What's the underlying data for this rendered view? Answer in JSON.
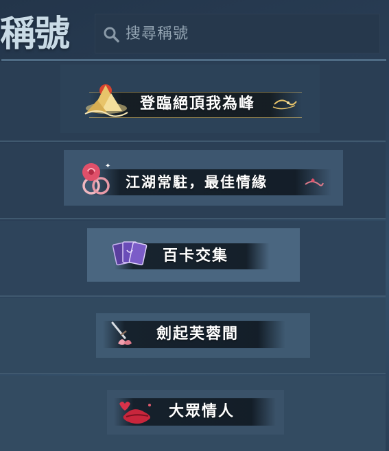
{
  "header": {
    "title": "稱號",
    "search": {
      "placeholder": "搜尋稱號",
      "icon": "search-icon"
    }
  },
  "titles": [
    {
      "label": "登臨絕頂我為峰",
      "icon": "golden-mountain-icon",
      "accent": "#e8c46a"
    },
    {
      "label": "江湖常駐，最佳情緣",
      "icon": "rose-rings-icon",
      "accent": "#e0506a"
    },
    {
      "label": "百卡交集",
      "icon": "purple-cards-icon",
      "accent": "#7b5cc8"
    },
    {
      "label": "劍起芙蓉間",
      "icon": "sword-lotus-icon",
      "accent": "#e07a8a"
    },
    {
      "label": "大眾情人",
      "icon": "red-lips-icon",
      "accent": "#c8263c"
    }
  ],
  "colors": {
    "background": "#2b4058",
    "plate": "#3a536b",
    "divider": "#40596f"
  }
}
